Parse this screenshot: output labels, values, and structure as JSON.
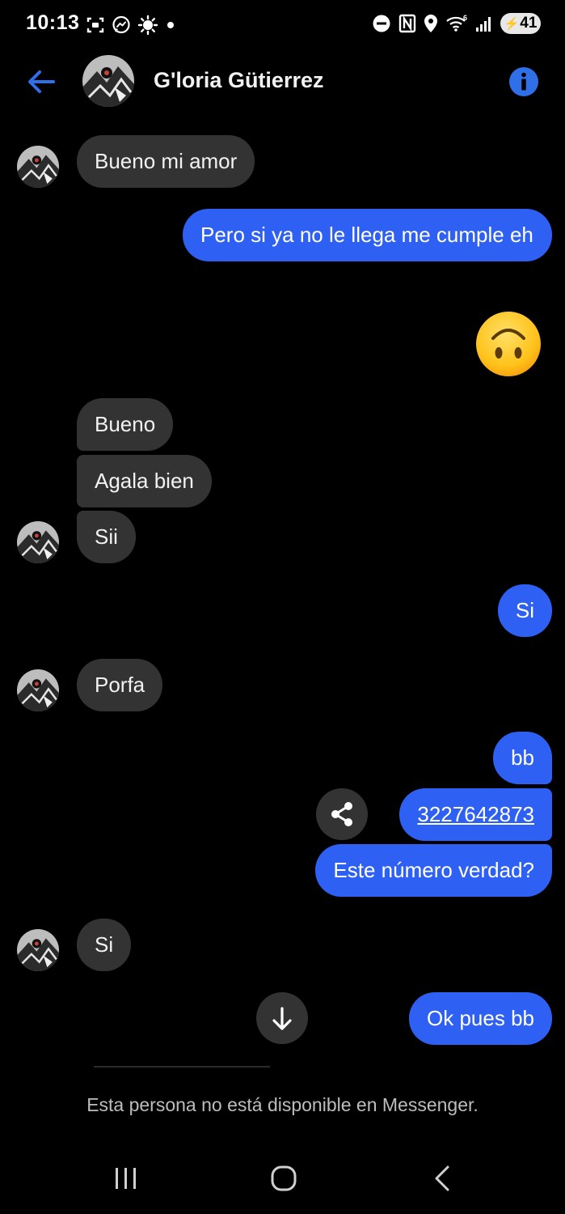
{
  "status_bar": {
    "time": "10:13",
    "battery_level": "41",
    "left_icons": [
      "screenshot-icon",
      "messenger-icon",
      "brightness-icon",
      "dot-icon"
    ],
    "right_icons": [
      "dnd-icon",
      "nfc-icon",
      "location-icon",
      "wifi-icon",
      "signal-icon",
      "battery-icon"
    ]
  },
  "header": {
    "contact_name": "G'loria Gütierrez",
    "accent_color": "#2f60f4"
  },
  "messages": [
    {
      "direction": "incoming",
      "text": "Bueno mi amor"
    },
    {
      "direction": "outgoing",
      "text": "Pero si ya no le llega me cumple eh"
    },
    {
      "direction": "outgoing",
      "type": "emoji",
      "emoji": "upside-down-face"
    },
    {
      "direction": "incoming",
      "text": "Bueno"
    },
    {
      "direction": "incoming",
      "text": "Agala bien"
    },
    {
      "direction": "incoming",
      "text": "Sii"
    },
    {
      "direction": "outgoing",
      "text": "Si"
    },
    {
      "direction": "incoming",
      "text": "Porfa"
    },
    {
      "direction": "outgoing",
      "text": "bb"
    },
    {
      "direction": "outgoing",
      "text": "3227642873",
      "is_link": true
    },
    {
      "direction": "outgoing",
      "text": "Este número verdad?"
    },
    {
      "direction": "incoming",
      "text": "Si"
    },
    {
      "direction": "outgoing",
      "text": "Ok pues bb"
    }
  ],
  "actions": {
    "share_icon": "share-icon",
    "scroll_down_icon": "arrow-down-icon"
  },
  "footer": {
    "unavailable_text": "Esta persona no está disponible en Messenger."
  },
  "nav_bar": {
    "items": [
      "recents-icon",
      "home-icon",
      "back-icon"
    ]
  },
  "colors": {
    "background": "#000000",
    "incoming_bubble": "#333333",
    "outgoing_bubble": "#2f60f4"
  }
}
